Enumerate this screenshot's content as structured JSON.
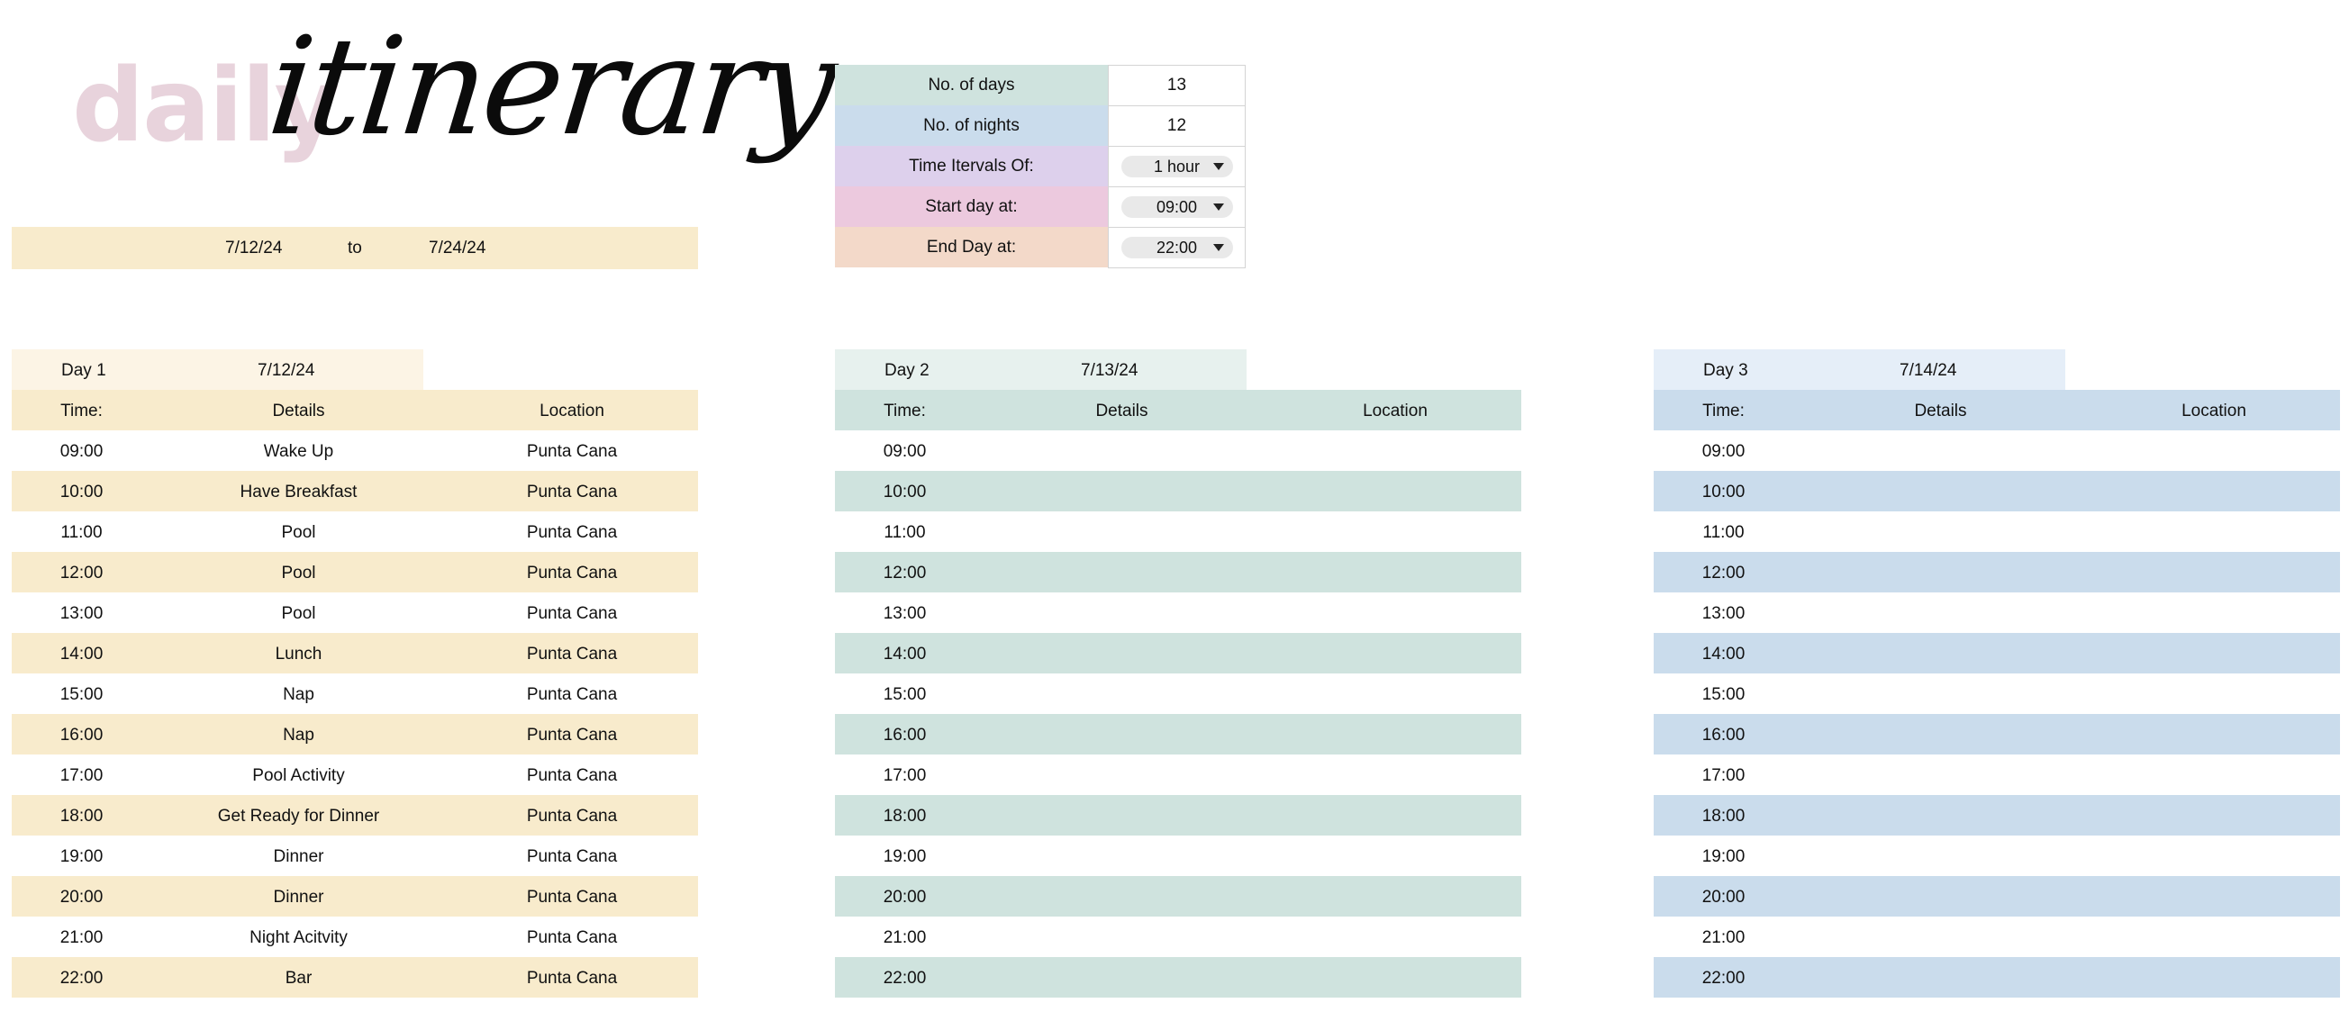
{
  "title": {
    "word1": "daily",
    "word2": "itinerary"
  },
  "date_range": {
    "start": "7/12/24",
    "to": "to",
    "end": "7/24/24"
  },
  "settings": [
    {
      "label": "No. of days",
      "value": "13",
      "type": "text",
      "color": "#cfe3de"
    },
    {
      "label": "No. of nights",
      "value": "12",
      "type": "text",
      "color": "#cadcec"
    },
    {
      "label": "Time Itervals Of:",
      "value": "1 hour",
      "type": "dropdown",
      "color": "#ddd0ec"
    },
    {
      "label": "Start day at:",
      "value": "09:00",
      "type": "dropdown",
      "color": "#ecc9de"
    },
    {
      "label": "End Day at:",
      "value": "22:00",
      "type": "dropdown",
      "color": "#f3d9c9"
    }
  ],
  "column_headers": {
    "time": "Time:",
    "details": "Details",
    "location": "Location"
  },
  "days": [
    {
      "label": "Day 1",
      "date": "7/12/24",
      "colors": {
        "head": "#fcf4e5",
        "band": "#f8ebcc"
      },
      "rows": [
        {
          "time": "09:00",
          "details": "Wake Up",
          "location": "Punta Cana"
        },
        {
          "time": "10:00",
          "details": "Have Breakfast",
          "location": "Punta Cana"
        },
        {
          "time": "11:00",
          "details": "Pool",
          "location": "Punta Cana"
        },
        {
          "time": "12:00",
          "details": "Pool",
          "location": "Punta Cana"
        },
        {
          "time": "13:00",
          "details": "Pool",
          "location": "Punta Cana"
        },
        {
          "time": "14:00",
          "details": "Lunch",
          "location": "Punta Cana"
        },
        {
          "time": "15:00",
          "details": "Nap",
          "location": "Punta Cana"
        },
        {
          "time": "16:00",
          "details": "Nap",
          "location": "Punta Cana"
        },
        {
          "time": "17:00",
          "details": "Pool Activity",
          "location": "Punta Cana"
        },
        {
          "time": "18:00",
          "details": "Get Ready for Dinner",
          "location": "Punta Cana"
        },
        {
          "time": "19:00",
          "details": "Dinner",
          "location": "Punta Cana"
        },
        {
          "time": "20:00",
          "details": "Dinner",
          "location": "Punta Cana"
        },
        {
          "time": "21:00",
          "details": "Night Acitvity",
          "location": "Punta Cana"
        },
        {
          "time": "22:00",
          "details": "Bar",
          "location": "Punta Cana"
        }
      ]
    },
    {
      "label": "Day 2",
      "date": "7/13/24",
      "colors": {
        "head": "#e7f1ee",
        "band": "#cfe3de"
      },
      "rows": [
        {
          "time": "09:00",
          "details": "",
          "location": ""
        },
        {
          "time": "10:00",
          "details": "",
          "location": ""
        },
        {
          "time": "11:00",
          "details": "",
          "location": ""
        },
        {
          "time": "12:00",
          "details": "",
          "location": ""
        },
        {
          "time": "13:00",
          "details": "",
          "location": ""
        },
        {
          "time": "14:00",
          "details": "",
          "location": ""
        },
        {
          "time": "15:00",
          "details": "",
          "location": ""
        },
        {
          "time": "16:00",
          "details": "",
          "location": ""
        },
        {
          "time": "17:00",
          "details": "",
          "location": ""
        },
        {
          "time": "18:00",
          "details": "",
          "location": ""
        },
        {
          "time": "19:00",
          "details": "",
          "location": ""
        },
        {
          "time": "20:00",
          "details": "",
          "location": ""
        },
        {
          "time": "21:00",
          "details": "",
          "location": ""
        },
        {
          "time": "22:00",
          "details": "",
          "location": ""
        }
      ]
    },
    {
      "label": "Day 3",
      "date": "7/14/24",
      "colors": {
        "head": "#e5eef8",
        "band": "#cadcec"
      },
      "rows": [
        {
          "time": "09:00",
          "details": "",
          "location": ""
        },
        {
          "time": "10:00",
          "details": "",
          "location": ""
        },
        {
          "time": "11:00",
          "details": "",
          "location": ""
        },
        {
          "time": "12:00",
          "details": "",
          "location": ""
        },
        {
          "time": "13:00",
          "details": "",
          "location": ""
        },
        {
          "time": "14:00",
          "details": "",
          "location": ""
        },
        {
          "time": "15:00",
          "details": "",
          "location": ""
        },
        {
          "time": "16:00",
          "details": "",
          "location": ""
        },
        {
          "time": "17:00",
          "details": "",
          "location": ""
        },
        {
          "time": "18:00",
          "details": "",
          "location": ""
        },
        {
          "time": "19:00",
          "details": "",
          "location": ""
        },
        {
          "time": "20:00",
          "details": "",
          "location": ""
        },
        {
          "time": "21:00",
          "details": "",
          "location": ""
        },
        {
          "time": "22:00",
          "details": "",
          "location": ""
        }
      ]
    }
  ]
}
